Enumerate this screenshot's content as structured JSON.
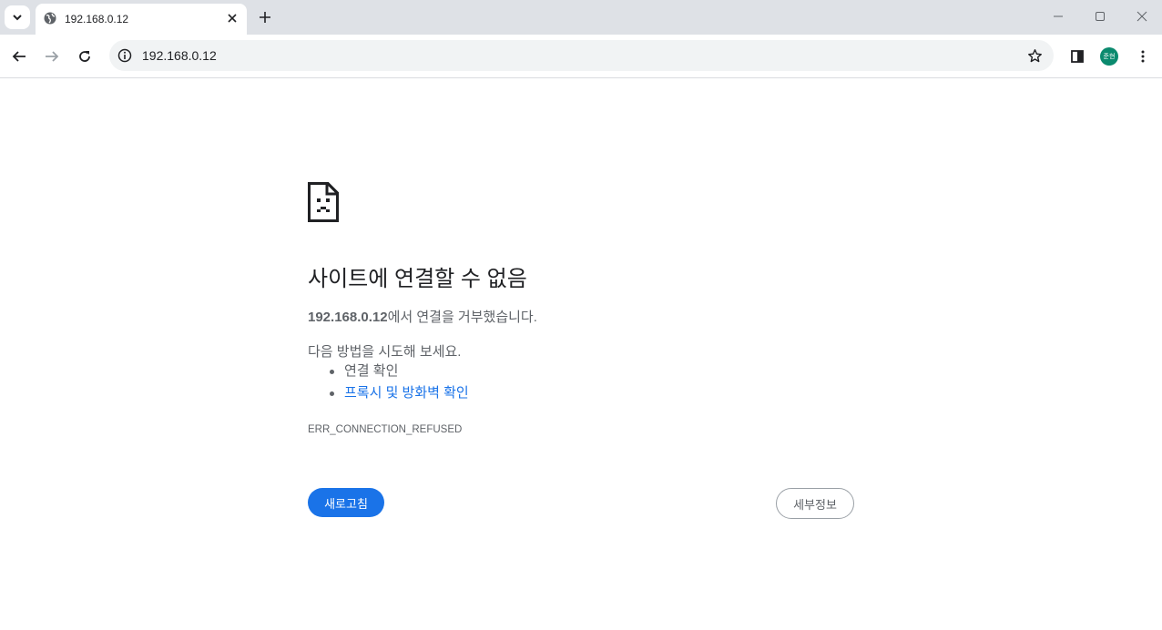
{
  "browser": {
    "tab_title": "192.168.0.12",
    "url": "192.168.0.12",
    "profile_initials": "준현"
  },
  "error_page": {
    "heading": "사이트에 연결할 수 없음",
    "summary_host": "192.168.0.12",
    "summary_rest": "에서 연결을 거부했습니다.",
    "suggestions_intro": "다음 방법을 시도해 보세요.",
    "suggestions": [
      "연결 확인",
      "프록시 및 방화벽 확인"
    ],
    "error_code": "ERR_CONNECTION_REFUSED",
    "reload_label": "새로고침",
    "details_label": "세부정보"
  },
  "colors": {
    "accent": "#1a73e8",
    "text_secondary": "#5f6368",
    "avatar_bg": "#0b8a6e"
  },
  "icons": [
    "tab-search-icon",
    "globe-icon",
    "close-icon",
    "plus-icon",
    "minimize-icon",
    "maximize-icon",
    "window-close-icon",
    "back-arrow-icon",
    "forward-arrow-icon",
    "reload-icon",
    "info-icon",
    "star-icon",
    "side-panel-icon",
    "kebab-menu-icon",
    "sad-page-icon"
  ]
}
